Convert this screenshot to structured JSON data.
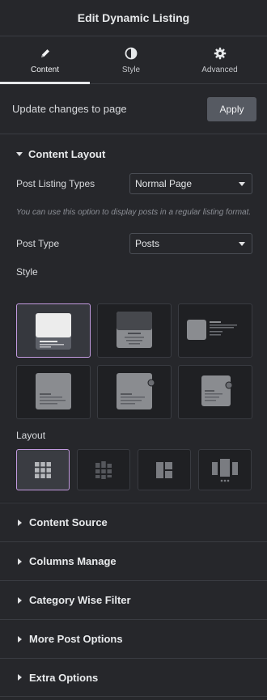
{
  "header": {
    "title": "Edit Dynamic Listing"
  },
  "tabs": [
    {
      "label": "Content",
      "icon": "pencil-icon",
      "active": true
    },
    {
      "label": "Style",
      "icon": "contrast-icon",
      "active": false
    },
    {
      "label": "Advanced",
      "icon": "gear-icon",
      "active": false
    }
  ],
  "update": {
    "label": "Update changes to page",
    "button": "Apply"
  },
  "content_layout": {
    "title": "Content Layout",
    "post_listing_types": {
      "label": "Post Listing Types",
      "value": "Normal Page"
    },
    "help_text": "You can use this option to display posts in a regular listing format.",
    "post_type": {
      "label": "Post Type",
      "value": "Posts"
    },
    "style_label": "Style",
    "style_selected_index": 0,
    "layout_label": "Layout",
    "layout_selected_index": 0
  },
  "sections": [
    "Content Source",
    "Columns Manage",
    "Category Wise Filter",
    "More Post Options",
    "Extra Options"
  ],
  "colors": {
    "panel_bg": "#26272b",
    "selected_border": "#c39be0",
    "apply_bg": "#565a62"
  }
}
